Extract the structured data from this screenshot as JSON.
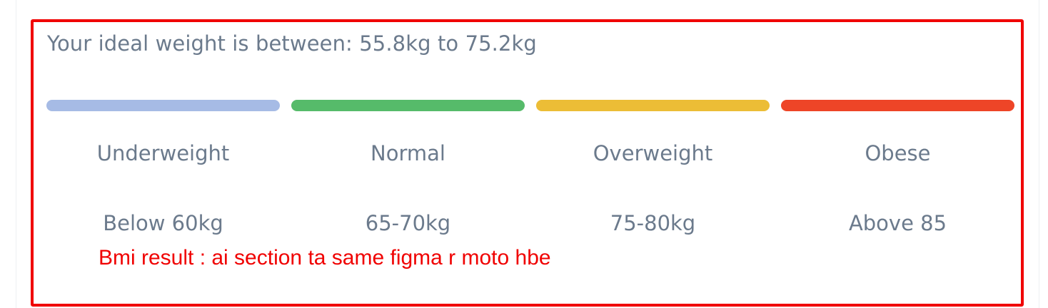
{
  "bmi_result": {
    "ideal_weight_text": "Your ideal weight is between: 55.8kg to 75.2kg",
    "categories": [
      {
        "label": "Underweight",
        "range": "Below 60kg",
        "color": "#a6bbe5"
      },
      {
        "label": "Normal",
        "range": "65-70kg",
        "color": "#56bb6a"
      },
      {
        "label": "Overweight",
        "range": "75-80kg",
        "color": "#ecbd36"
      },
      {
        "label": "Obese",
        "range": "Above 85",
        "color": "#ee4527"
      }
    ]
  },
  "annotation": {
    "note": "Bmi result : ai section ta same figma r moto hbe",
    "color": "#f00000"
  }
}
